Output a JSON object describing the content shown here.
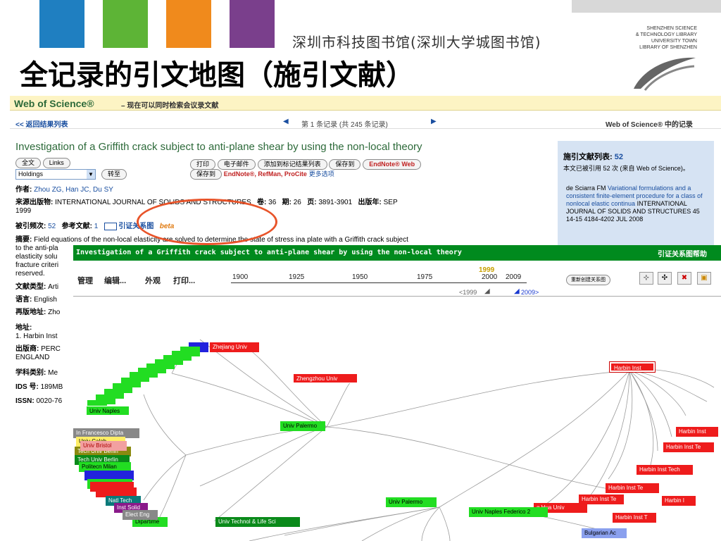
{
  "slide": {
    "title": "全记录的引文地图（施引文献）",
    "library_cn": "深圳市科技图书馆(深圳大学城图书馆)",
    "library_en": [
      "SHENZHEN SCIENCE",
      "& TECHNOLOGY LIBRARY",
      "UNIVERSITY TOWN",
      "LIBRARY OF SHENZHEN"
    ],
    "bar_colors": [
      "#1f7fc1",
      "#5db436",
      "#f08a1c",
      "#7a3f8c",
      "#d8d8d8"
    ]
  },
  "wos": {
    "brand": "Web of Science®",
    "brand_sub": "– 现在可以同时检索会议录文献",
    "back_link": "<< 返回结果列表",
    "record_nav": "第 1 条记录 (共 245 条记录)",
    "right_nav": "Web of Science® 中的记录",
    "article_title": "Investigation of a Griffith crack subject to anti-plane shear by using the non-local theory",
    "buttons": {
      "fulltext": "全文",
      "links": "Links",
      "holdings": "Holdings",
      "goto": "转至",
      "print": "打印",
      "email": "电子邮件",
      "add_marked": "添加到标记结果列表",
      "save_to": "保存到",
      "endnote_web": "EndNote® Web",
      "save_to2": "保存到",
      "endnote_refman": "EndNote®, RefMan, ProCite",
      "more": "更多选项"
    },
    "authors_label": "作者:",
    "authors": "Zhou ZG, Han JC, Du SY",
    "source_label": "来源出版物:",
    "source": "INTERNATIONAL JOURNAL OF SOLIDS AND STRUCTURES",
    "volume_label": "卷:",
    "volume": "36",
    "issue_label": "期:",
    "issue": "26",
    "pages_label": "页:",
    "pages": "3891-3901",
    "year_label": "出版年:",
    "year": "SEP",
    "year2": "1999",
    "cited_label": "被引频次:",
    "cited": "52",
    "refs_label": "参考文献:",
    "refs": "1",
    "citation_map": "引证关系图",
    "beta": "beta",
    "abstract_label": "摘要:",
    "abstract": "Field equations of the non-local elasticity are solved to determine the state of stress ina plate with a Griffith crack subject",
    "abstract_lines": [
      "to the anti-pla",
      "elasticity solu",
      "fracture criteri",
      "reserved."
    ],
    "doctype_label": "文献类型:",
    "doctype": "Arti",
    "language_label": "语言:",
    "language": "English",
    "reprint_label": "再版地址:",
    "reprint": "Zho",
    "address_label": "地址:",
    "address": "1. Harbin Inst",
    "publisher_label": "出版商:",
    "publisher": "PERC",
    "publisher2": "ENGLAND",
    "subject_label": "学科类别:",
    "subject": "Me",
    "ids_label": "IDS 号:",
    "ids": "189MB",
    "issn_label": "ISSN:",
    "issn": "0020-76",
    "panel": {
      "heading": "施引文献列表:",
      "count": "52",
      "note": "本文已被引用 52 次 (来自 Web of Science)。",
      "item_author": "de Sciarra FM",
      "item_title": "Variational formulations and a consistent finite-element procedure for a class of nonlocal elastic continua",
      "item_source": "INTERNATIONAL JOURNAL OF SOLIDS AND STRUCTURES 45 14-15 4184-4202 JUL 2008"
    }
  },
  "map": {
    "title": "Investigation of a Griffith crack subject to anti-plane shear by using the non-local theory",
    "help": "引证关系图帮助",
    "menu": [
      "管理",
      "编辑...",
      "外观",
      "打印..."
    ],
    "years": [
      "1900",
      "1925",
      "1950",
      "1975",
      "2000",
      "2009"
    ],
    "current_year": "1999",
    "range_left": "<1999",
    "range_right": "2009>",
    "recreate": "重新创建关系图",
    "nodes": [
      {
        "label": "Zhejiang Univ",
        "color": "red"
      },
      {
        "label": "Zhengzhou Univ",
        "color": "red"
      },
      {
        "label": "Harbin Inst",
        "color": "red"
      },
      {
        "label": "Univ Palermo",
        "color": "green"
      },
      {
        "label": "Univ Naples",
        "color": "green"
      },
      {
        "label": "Harbin Inst",
        "color": "red"
      },
      {
        "label": "Harbin Inst Te",
        "color": "red"
      },
      {
        "label": "Harbin Inst Tech",
        "color": "red"
      },
      {
        "label": "Harbin Inst Te",
        "color": "red"
      },
      {
        "label": "Harbin Inst Te",
        "color": "red"
      },
      {
        "label": "Harbin I",
        "color": "red"
      },
      {
        "label": "Harbin Inst T",
        "color": "red"
      },
      {
        "label": "g Hua Univ",
        "color": "red"
      },
      {
        "label": "Univ Palermo",
        "color": "green"
      },
      {
        "label": "Univ Naples Federico 2",
        "color": "green"
      },
      {
        "label": "Univ Technol & Life Sci",
        "color": "dgreen"
      },
      {
        "label": "Bulgarian Ac",
        "color": "lblue"
      },
      {
        "label": "Dipartime",
        "color": "green"
      },
      {
        "label": "Tech Univ Berlin",
        "color": "olive"
      },
      {
        "label": "Tech Univ Berlin",
        "color": "dgreen"
      },
      {
        "label": "Politecn Milan",
        "color": "green"
      },
      {
        "label": "Natl Tech",
        "color": "teal"
      },
      {
        "label": "Inst Solid",
        "color": "purple"
      },
      {
        "label": "Elect Eng",
        "color": "gray"
      },
      {
        "label": "In Francesco Dipta",
        "color": "gray"
      },
      {
        "label": "Univ Bristol",
        "color": "pink"
      },
      {
        "label": "Univ Calab",
        "color": "yellow"
      }
    ]
  }
}
